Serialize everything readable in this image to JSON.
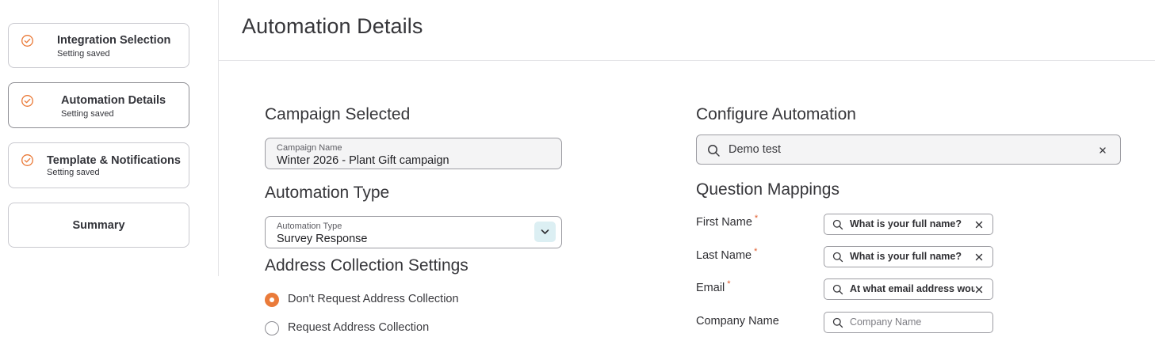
{
  "sidebar": {
    "steps": [
      {
        "title": "Integration Selection",
        "status": "Setting saved"
      },
      {
        "title": "Automation Details",
        "status": "Setting saved"
      },
      {
        "title": "Template & Notifications",
        "status": "Setting saved"
      },
      {
        "title": "Summary"
      }
    ]
  },
  "header": {
    "title": "Automation Details"
  },
  "campaign": {
    "section_title": "Campaign Selected",
    "field_label": "Campaign Name",
    "field_value": "Winter 2026 - Plant Gift campaign"
  },
  "automation_type": {
    "section_title": "Automation Type",
    "field_label": "Automation Type",
    "selected": "Survey Response"
  },
  "address_collection": {
    "section_title": "Address Collection Settings",
    "options": [
      {
        "label": "Don't Request Address Collection",
        "selected": true
      },
      {
        "label": "Request Address Collection",
        "selected": false
      }
    ]
  },
  "configure": {
    "section_title": "Configure Automation",
    "search_value": "Demo test"
  },
  "question_mappings": {
    "section_title": "Question Mappings",
    "required_marker": "*",
    "rows": [
      {
        "label": "First Name",
        "required": true,
        "value": "What is your full name?"
      },
      {
        "label": "Last Name",
        "required": true,
        "value": "What is your full name?"
      },
      {
        "label": "Email",
        "required": true,
        "value": "At what email address would you like to receive your gift?"
      },
      {
        "label": "Company Name",
        "required": false,
        "value": "",
        "placeholder": "Company Name"
      }
    ]
  },
  "colors": {
    "accent": "#EA7B3A",
    "required": "#E05A2A",
    "dropdown_button_bg": "#DCEFF3"
  }
}
